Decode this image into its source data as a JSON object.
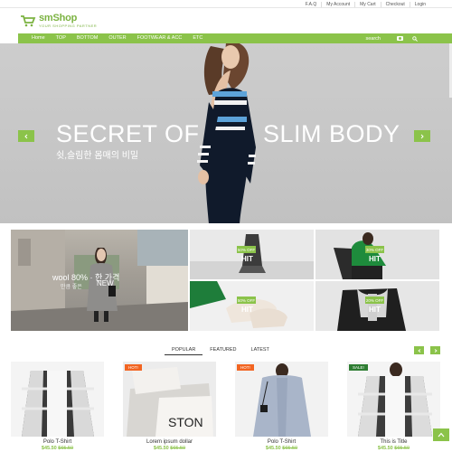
{
  "topbar": {
    "links": [
      "F.A.Q",
      "My Account",
      "My Cart",
      "Checkout",
      "Login"
    ]
  },
  "logo": {
    "name": "smShop",
    "tagline": "YOUR SHOPPING PARTNER"
  },
  "nav": {
    "items": [
      "Home",
      "TOP",
      "BOTTOM",
      "OUTER",
      "FOOTWEAR & ACC",
      "ETC"
    ],
    "search_label": "search"
  },
  "hero": {
    "title_left": "SECRET OF",
    "title_right": "SLIM BODY",
    "subtitle": "쉿,슬림한 몸매의 비밀",
    "accent_color": "#8bc34a"
  },
  "banners": {
    "big_text": "wool 80%  ·  한 가격",
    "big_sub": "만큼 좋은",
    "big_new": "NEW",
    "tiles": [
      {
        "off": "50% OFF",
        "hit": "HIT"
      },
      {
        "off": "30% OFF",
        "hit": "HIT"
      },
      {
        "off": "50% OFF",
        "hit": "HIT"
      },
      {
        "off": "20% OFF",
        "hit": "HIT"
      }
    ]
  },
  "tabs": [
    "POPULAR",
    "FEATURED",
    "LATEST"
  ],
  "products": [
    {
      "name": "Polo T-Shirt",
      "price": "$45.50",
      "old_price": "$65.50",
      "badge": ""
    },
    {
      "name": "Lorem ipsum dollar",
      "price": "$45.50",
      "old_price": "$65.50",
      "badge": "HOT!"
    },
    {
      "name": "Polo T-Shirt",
      "price": "$45.50",
      "old_price": "$65.50",
      "badge": "HOT!"
    },
    {
      "name": "This is Title",
      "price": "$45.50",
      "old_price": "$65.50",
      "badge": "SALE!"
    }
  ],
  "icons": {
    "cart": "shopping-cart-icon",
    "camera": "camera-icon",
    "search": "search-icon",
    "prev": "chevron-left-icon",
    "next": "chevron-right-icon",
    "top": "chevron-up-icon"
  },
  "colors": {
    "brand": "#8bc34a",
    "hot": "#f26522",
    "sale": "#2e7d32"
  }
}
